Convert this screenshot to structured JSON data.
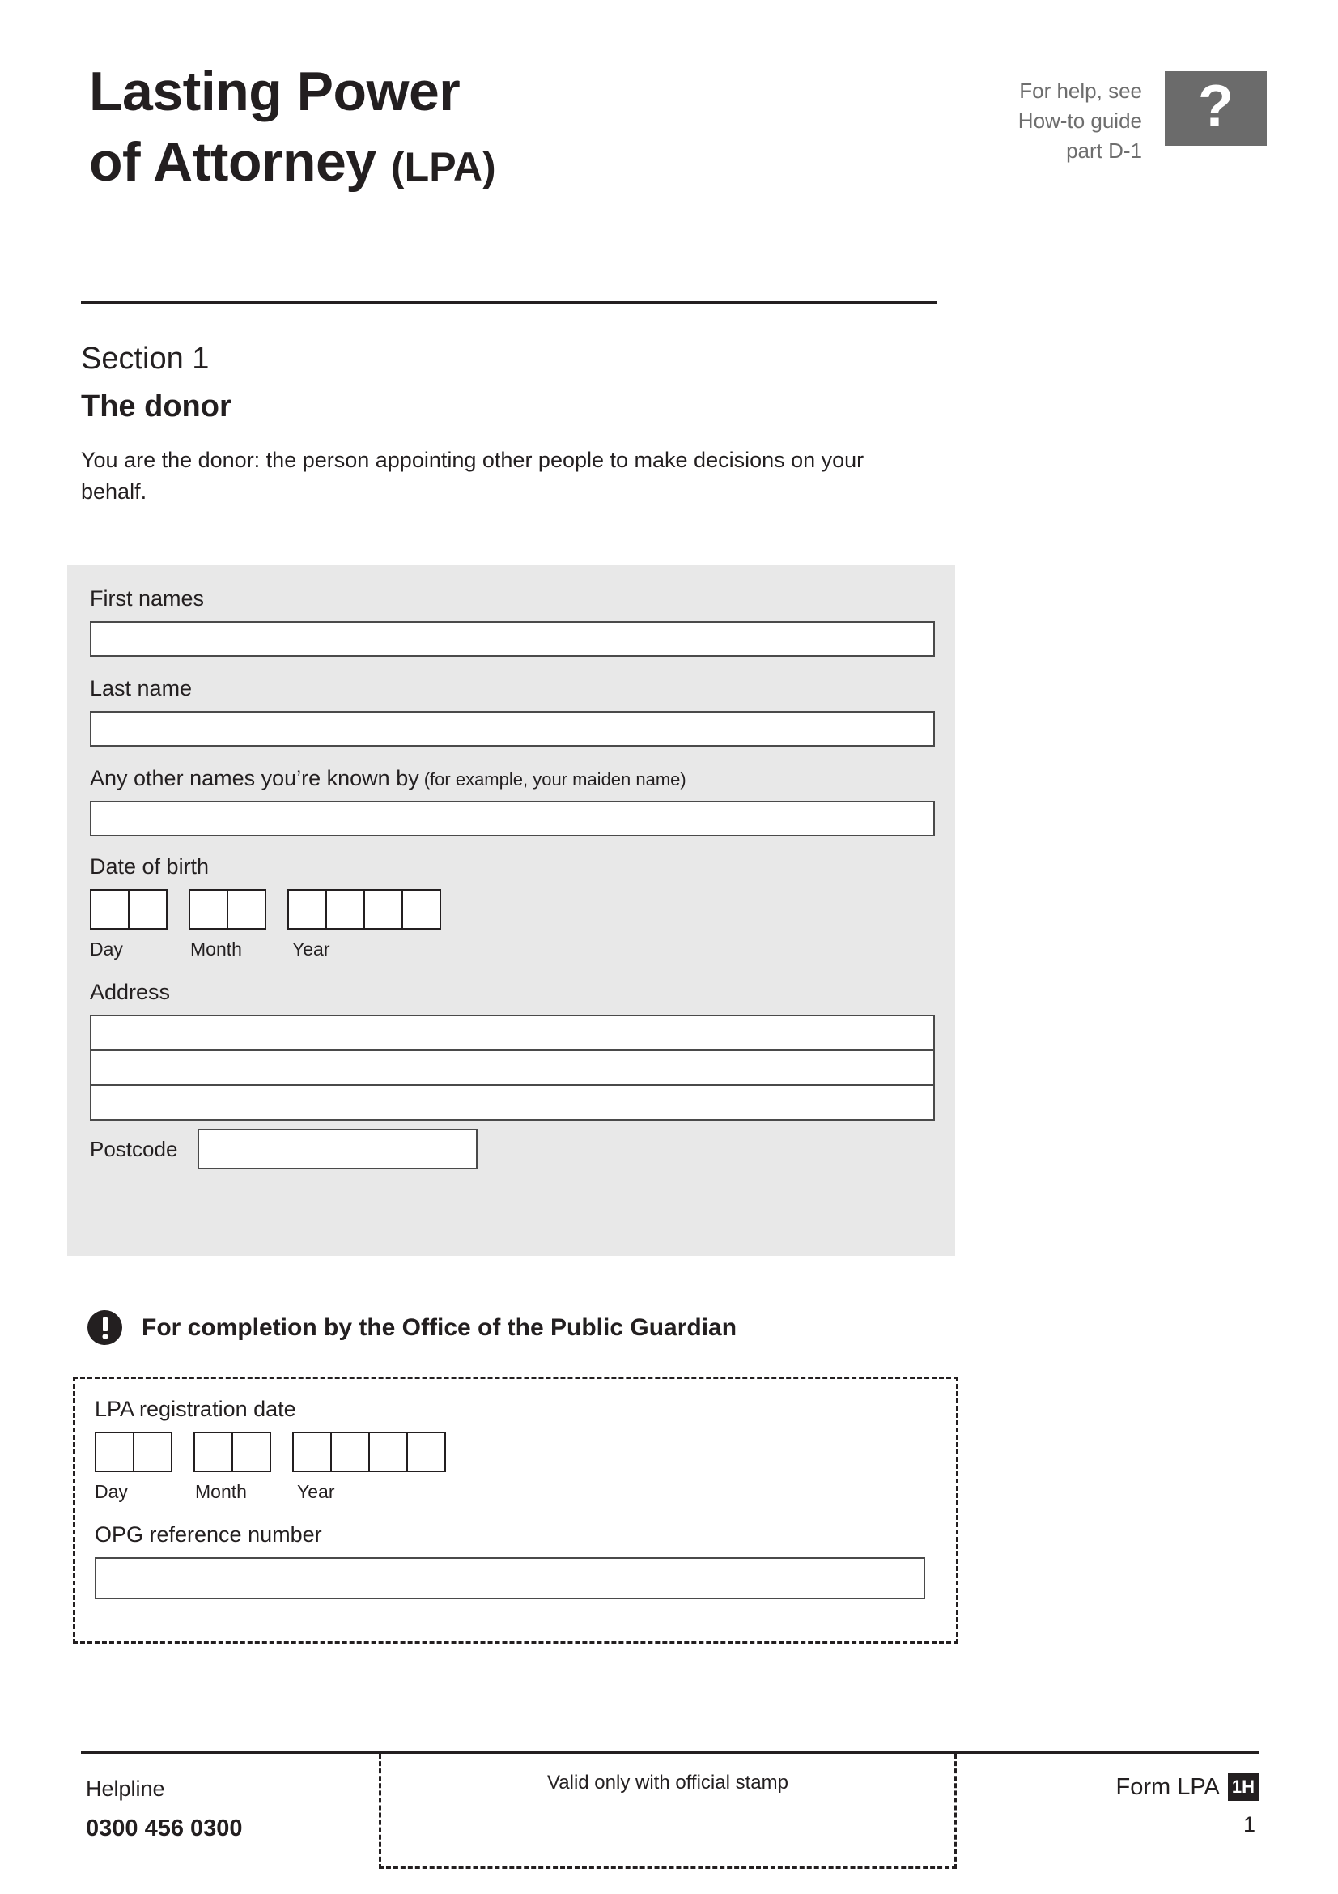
{
  "header": {
    "title_line_1": "Lasting Power",
    "title_line_2": "of Attorney",
    "title_abbr": "(LPA)",
    "help_line_1": "For help, see",
    "help_line_2": "How-to guide",
    "help_line_3": "part D-1",
    "help_icon_glyph": "?",
    "help_icon_name": "question-mark-icon",
    "help_box_color": "#6b6b6b"
  },
  "section": {
    "number_label": "Section 1",
    "title": "The donor",
    "intro": "You are the donor: the person appointing other people to make decisions on your behalf."
  },
  "donor_panel": {
    "background_color": "#e8e8e8",
    "fields": {
      "first_names_label": "First names",
      "first_names_value": "",
      "last_name_label": "Last name",
      "last_name_value": "",
      "other_names_label": "Any other names you’re known by",
      "other_names_hint": "(for example, your maiden name)",
      "other_names_value": "",
      "date_of_birth_label": "Date of birth",
      "day_caption": "Day",
      "month_caption": "Month",
      "year_caption": "Year",
      "day_cells": [
        "",
        ""
      ],
      "month_cells": [
        "",
        ""
      ],
      "year_cells": [
        "",
        "",
        "",
        ""
      ],
      "address_label": "Address",
      "address_lines": [
        "",
        "",
        ""
      ],
      "postcode_label": "Postcode",
      "postcode_value": ""
    }
  },
  "opg": {
    "heading": "For completion by the Office of the Public Guardian",
    "warning_icon_name": "exclamation-icon",
    "registration_date_label": "LPA registration date",
    "day_caption": "Day",
    "month_caption": "Month",
    "year_caption": "Year",
    "day_cells": [
      "",
      ""
    ],
    "month_cells": [
      "",
      ""
    ],
    "year_cells": [
      "",
      "",
      "",
      ""
    ],
    "reference_label": "OPG reference number",
    "reference_value": ""
  },
  "footer": {
    "helpline_label": "Helpline",
    "helpline_number": "0300 456 0300",
    "stamp_text": "Valid only with official stamp",
    "form_label": "Form LPA",
    "form_badge": "1H",
    "page_number": "1"
  }
}
